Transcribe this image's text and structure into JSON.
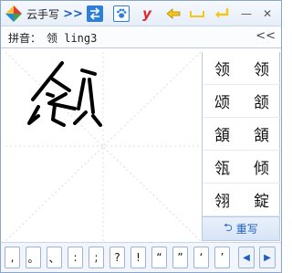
{
  "app": {
    "title": "云手写"
  },
  "toolbar": {
    "expand_glyph": ">>",
    "y_label": "y",
    "minimize_glyph": "—",
    "close_glyph": "✕"
  },
  "pinyin": {
    "label": "拼音：",
    "value": "领 ling3",
    "collapse_glyph": "<<"
  },
  "candidates": [
    "领",
    "领",
    "颂",
    "颔",
    "頷",
    "頷",
    "瓴",
    "倾",
    "翎",
    "錠"
  ],
  "rewrite": {
    "arrow": "⮌",
    "label": "重写"
  },
  "punctuation": [
    ",",
    "。",
    "、",
    ":",
    ";",
    "?",
    "!",
    "“",
    "”",
    "‘",
    "’"
  ],
  "nav": {
    "prev": "◀",
    "next": "▶"
  },
  "colors": {
    "accent": "#1f5fbf",
    "border": "#b9cbe4",
    "stroke": "#000000"
  }
}
